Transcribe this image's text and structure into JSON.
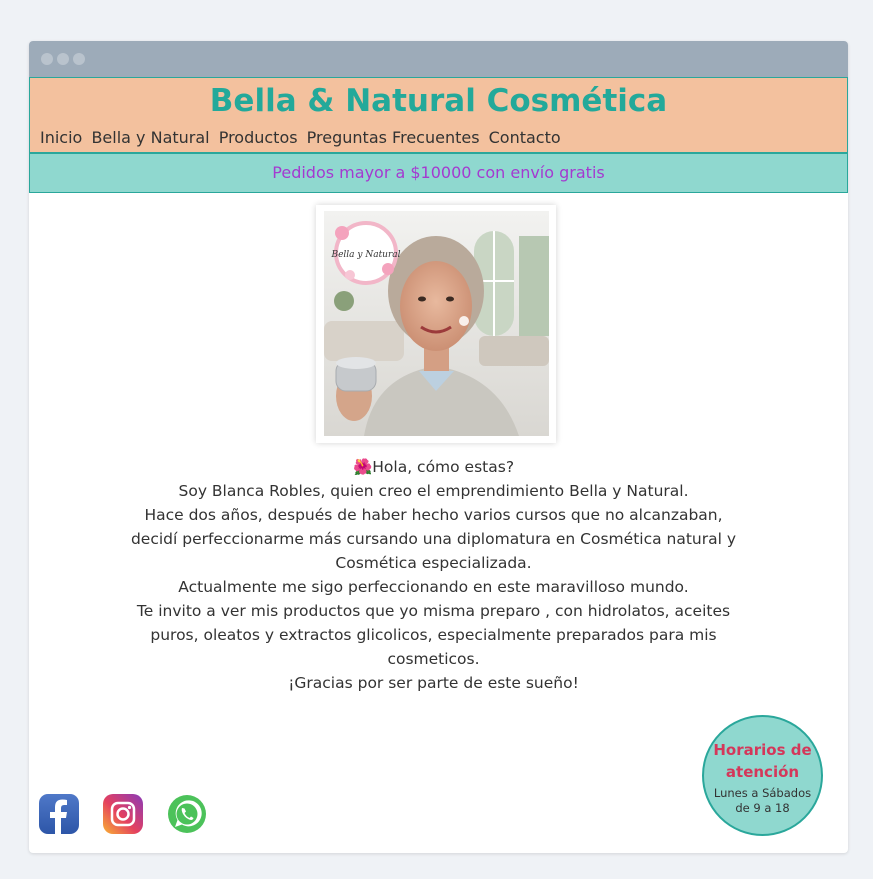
{
  "site": {
    "title": "Bella & Natural Cosmética"
  },
  "nav": {
    "items": [
      "Inicio",
      "Bella y Natural",
      "Productos",
      "Preguntas Frecuentes",
      "Contacto"
    ]
  },
  "promo": {
    "text": "Pedidos mayor a $10000 con envío gratis"
  },
  "photo": {
    "logo_text": "Bella y Natural"
  },
  "bio": {
    "greeting_emoji": "🌺",
    "lines": [
      "Hola, cómo estas?",
      "Soy Blanca Robles, quien creo el emprendimiento Bella y Natural.",
      "Hace dos años, después de haber hecho varios cursos que no alcanzaban, decidí perfeccionarme más cursando una diplomatura en Cosmética natural y Cosmética especializada.",
      "Actualmente me sigo perfeccionando en este maravilloso mundo.",
      "Te invito a ver mis productos que yo misma preparo , con hidrolatos, aceites puros, oleatos y extractos glicolicos, especialmente preparados para mis cosmeticos.",
      "¡Gracias por ser parte de este sueño!"
    ]
  },
  "social": {
    "icons": [
      "facebook-icon",
      "instagram-icon",
      "whatsapp-icon"
    ]
  },
  "hours": {
    "title": "Horarios de atención",
    "days": "Lunes a Sábados",
    "time": "de 9 a 18"
  },
  "colors": {
    "brand": "#23a99a",
    "header_bg": "#f3c19e",
    "promo_bg": "#8fd8cf",
    "promo_text": "#a43ad0",
    "hours_title": "#d4375a"
  }
}
